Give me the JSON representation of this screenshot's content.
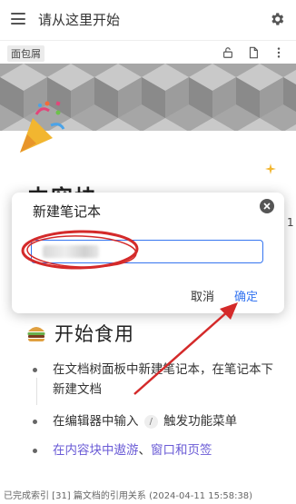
{
  "header": {
    "title": "请从这里开始",
    "menu_icon": "hamburger-menu-icon",
    "settings_icon": "gear-icon"
  },
  "toolbar": {
    "breadcrumb": "面包屑",
    "icons": [
      "unlock-icon",
      "document-icon",
      "more-vertical-icon"
    ]
  },
  "document": {
    "heading": "内容块",
    "side_number": "1",
    "section_title": "开始食用",
    "list": [
      {
        "text": "在文档树面板中新建笔记本，在笔记本下新建文档"
      },
      {
        "prefix": "在编辑器中输入",
        "key": "/",
        "suffix": "触发功能菜单"
      },
      {
        "link1": "在内容块中遨游",
        "separator": "、",
        "link2": "窗口和页签"
      }
    ]
  },
  "dialog": {
    "title": "新建笔记本",
    "input_value": "",
    "cancel_label": "取消",
    "ok_label": "确定"
  },
  "status_bar": {
    "text": "已完成索引 [31] 篇文档的引用关系 (2024-04-11 15:58:38)"
  },
  "colors": {
    "accent": "#3575f0",
    "link": "#6a5bd6",
    "annotation_red": "#d42a2a"
  }
}
